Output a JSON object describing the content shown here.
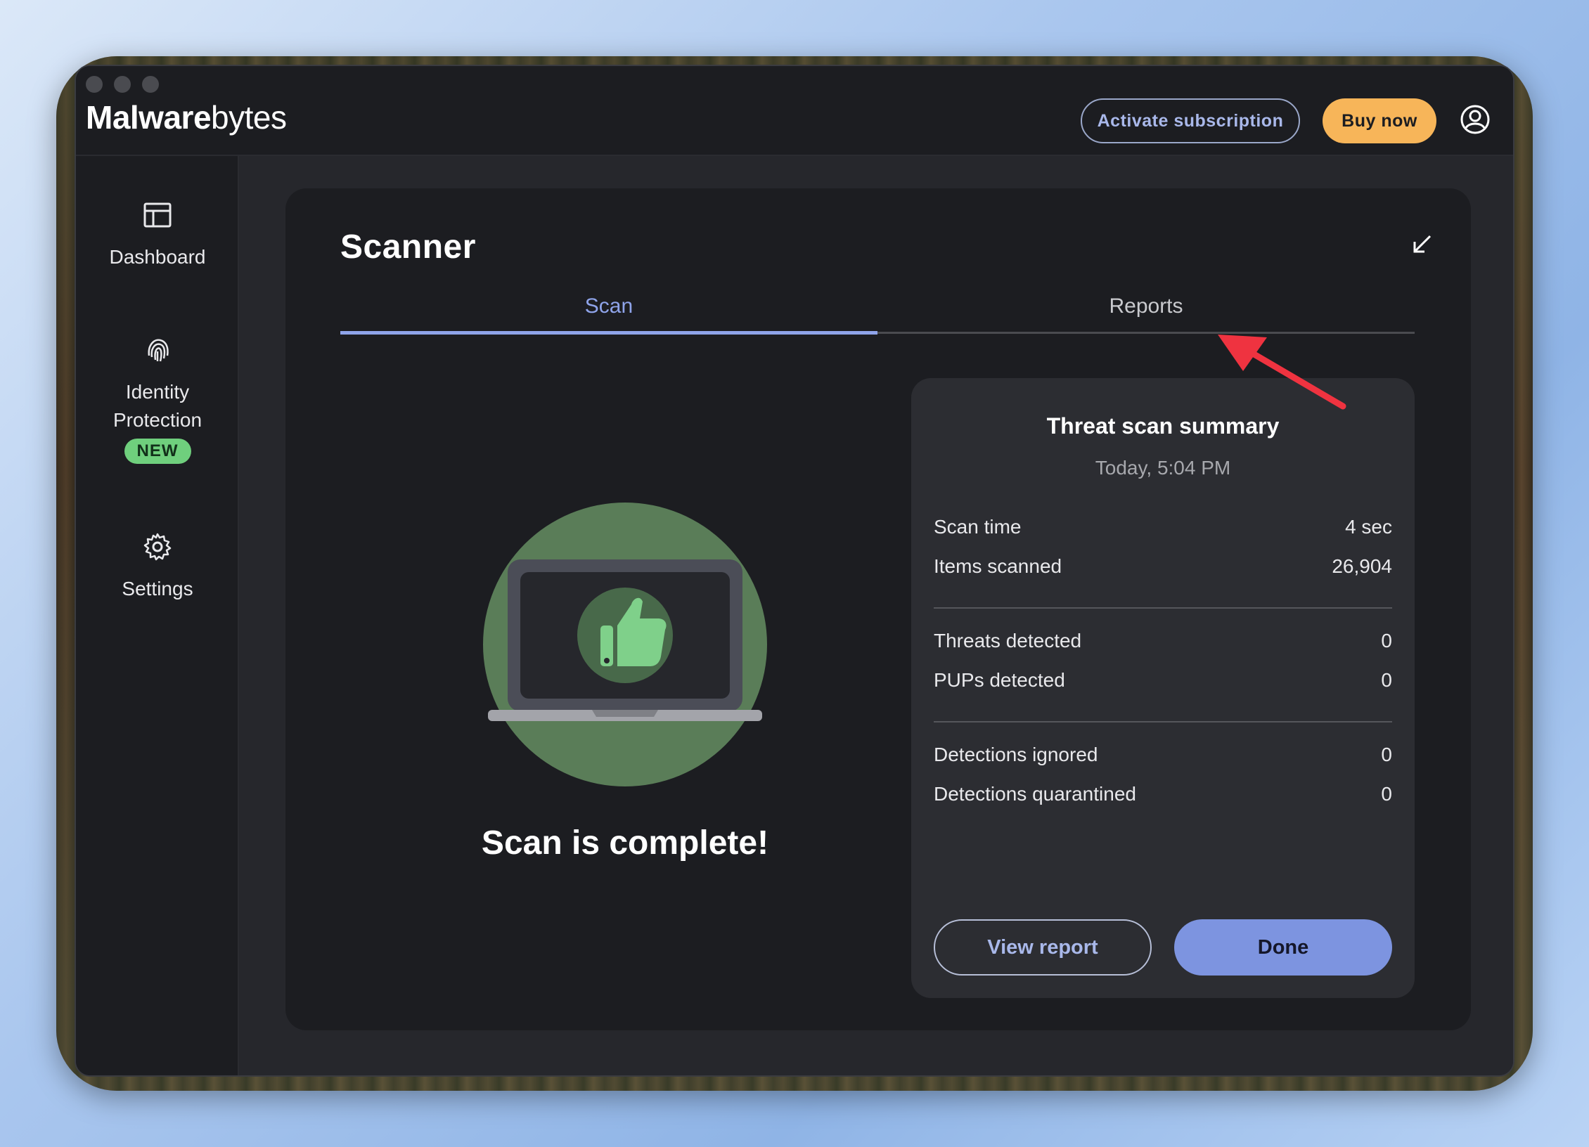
{
  "app": {
    "logo_bold": "Malware",
    "logo_light": "bytes"
  },
  "header": {
    "activate_label": "Activate subscription",
    "buy_label": "Buy now",
    "account_icon": "account-circle-icon"
  },
  "sidebar": {
    "items": [
      {
        "label": "Dashboard",
        "icon": "dashboard-icon"
      },
      {
        "label": "Identity\nProtection",
        "label_line1": "Identity",
        "label_line2": "Protection",
        "icon": "fingerprint-icon",
        "badge": "NEW"
      },
      {
        "label": "Settings",
        "icon": "gear-icon"
      }
    ]
  },
  "scanner": {
    "title": "Scanner",
    "tabs": [
      {
        "label": "Scan",
        "active": true
      },
      {
        "label": "Reports",
        "active": false
      }
    ],
    "status_text": "Scan is complete!"
  },
  "summary": {
    "title": "Threat scan summary",
    "date": "Today, 5:04 PM",
    "rows": [
      {
        "label": "Scan time",
        "value": "4 sec"
      },
      {
        "label": "Items scanned",
        "value": "26,904"
      },
      {
        "label": "Threats detected",
        "value": "0"
      },
      {
        "label": "PUPs detected",
        "value": "0"
      },
      {
        "label": "Detections ignored",
        "value": "0"
      },
      {
        "label": "Detections quarantined",
        "value": "0"
      }
    ],
    "view_report_label": "View report",
    "done_label": "Done"
  },
  "colors": {
    "accent": "#8fa4ea",
    "buy": "#f7b559",
    "badge": "#6fcf7d",
    "illustration": "#5a7d58",
    "annotation": "#ef3340"
  }
}
